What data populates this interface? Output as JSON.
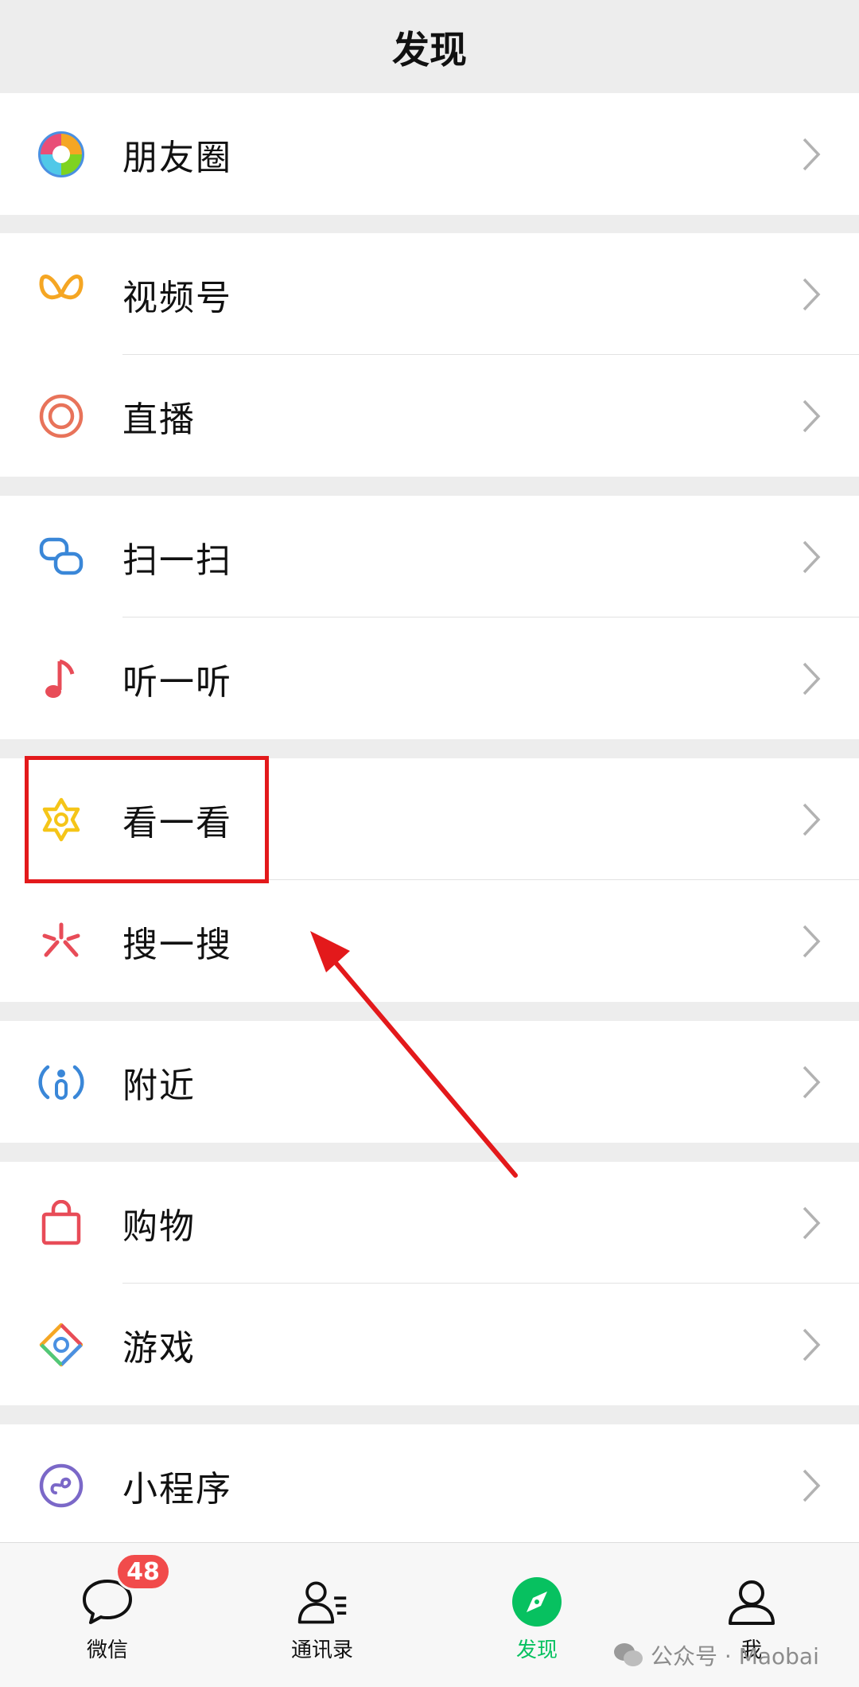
{
  "header": {
    "title": "发现"
  },
  "menu": {
    "moments": "朋友圈",
    "channels": "视频号",
    "live": "直播",
    "scan": "扫一扫",
    "listen": "听一听",
    "top_stories": "看一看",
    "search": "搜一搜",
    "nearby": "附近",
    "shopping": "购物",
    "games": "游戏",
    "mini_programs": "小程序"
  },
  "tabbar": {
    "chats": "微信",
    "chats_badge": "48",
    "contacts": "通讯录",
    "discover": "发现",
    "me": "我",
    "active_color": "#07c160"
  },
  "watermark": "公众号 · Maobai",
  "annotation": {
    "color": "#e3191b"
  }
}
